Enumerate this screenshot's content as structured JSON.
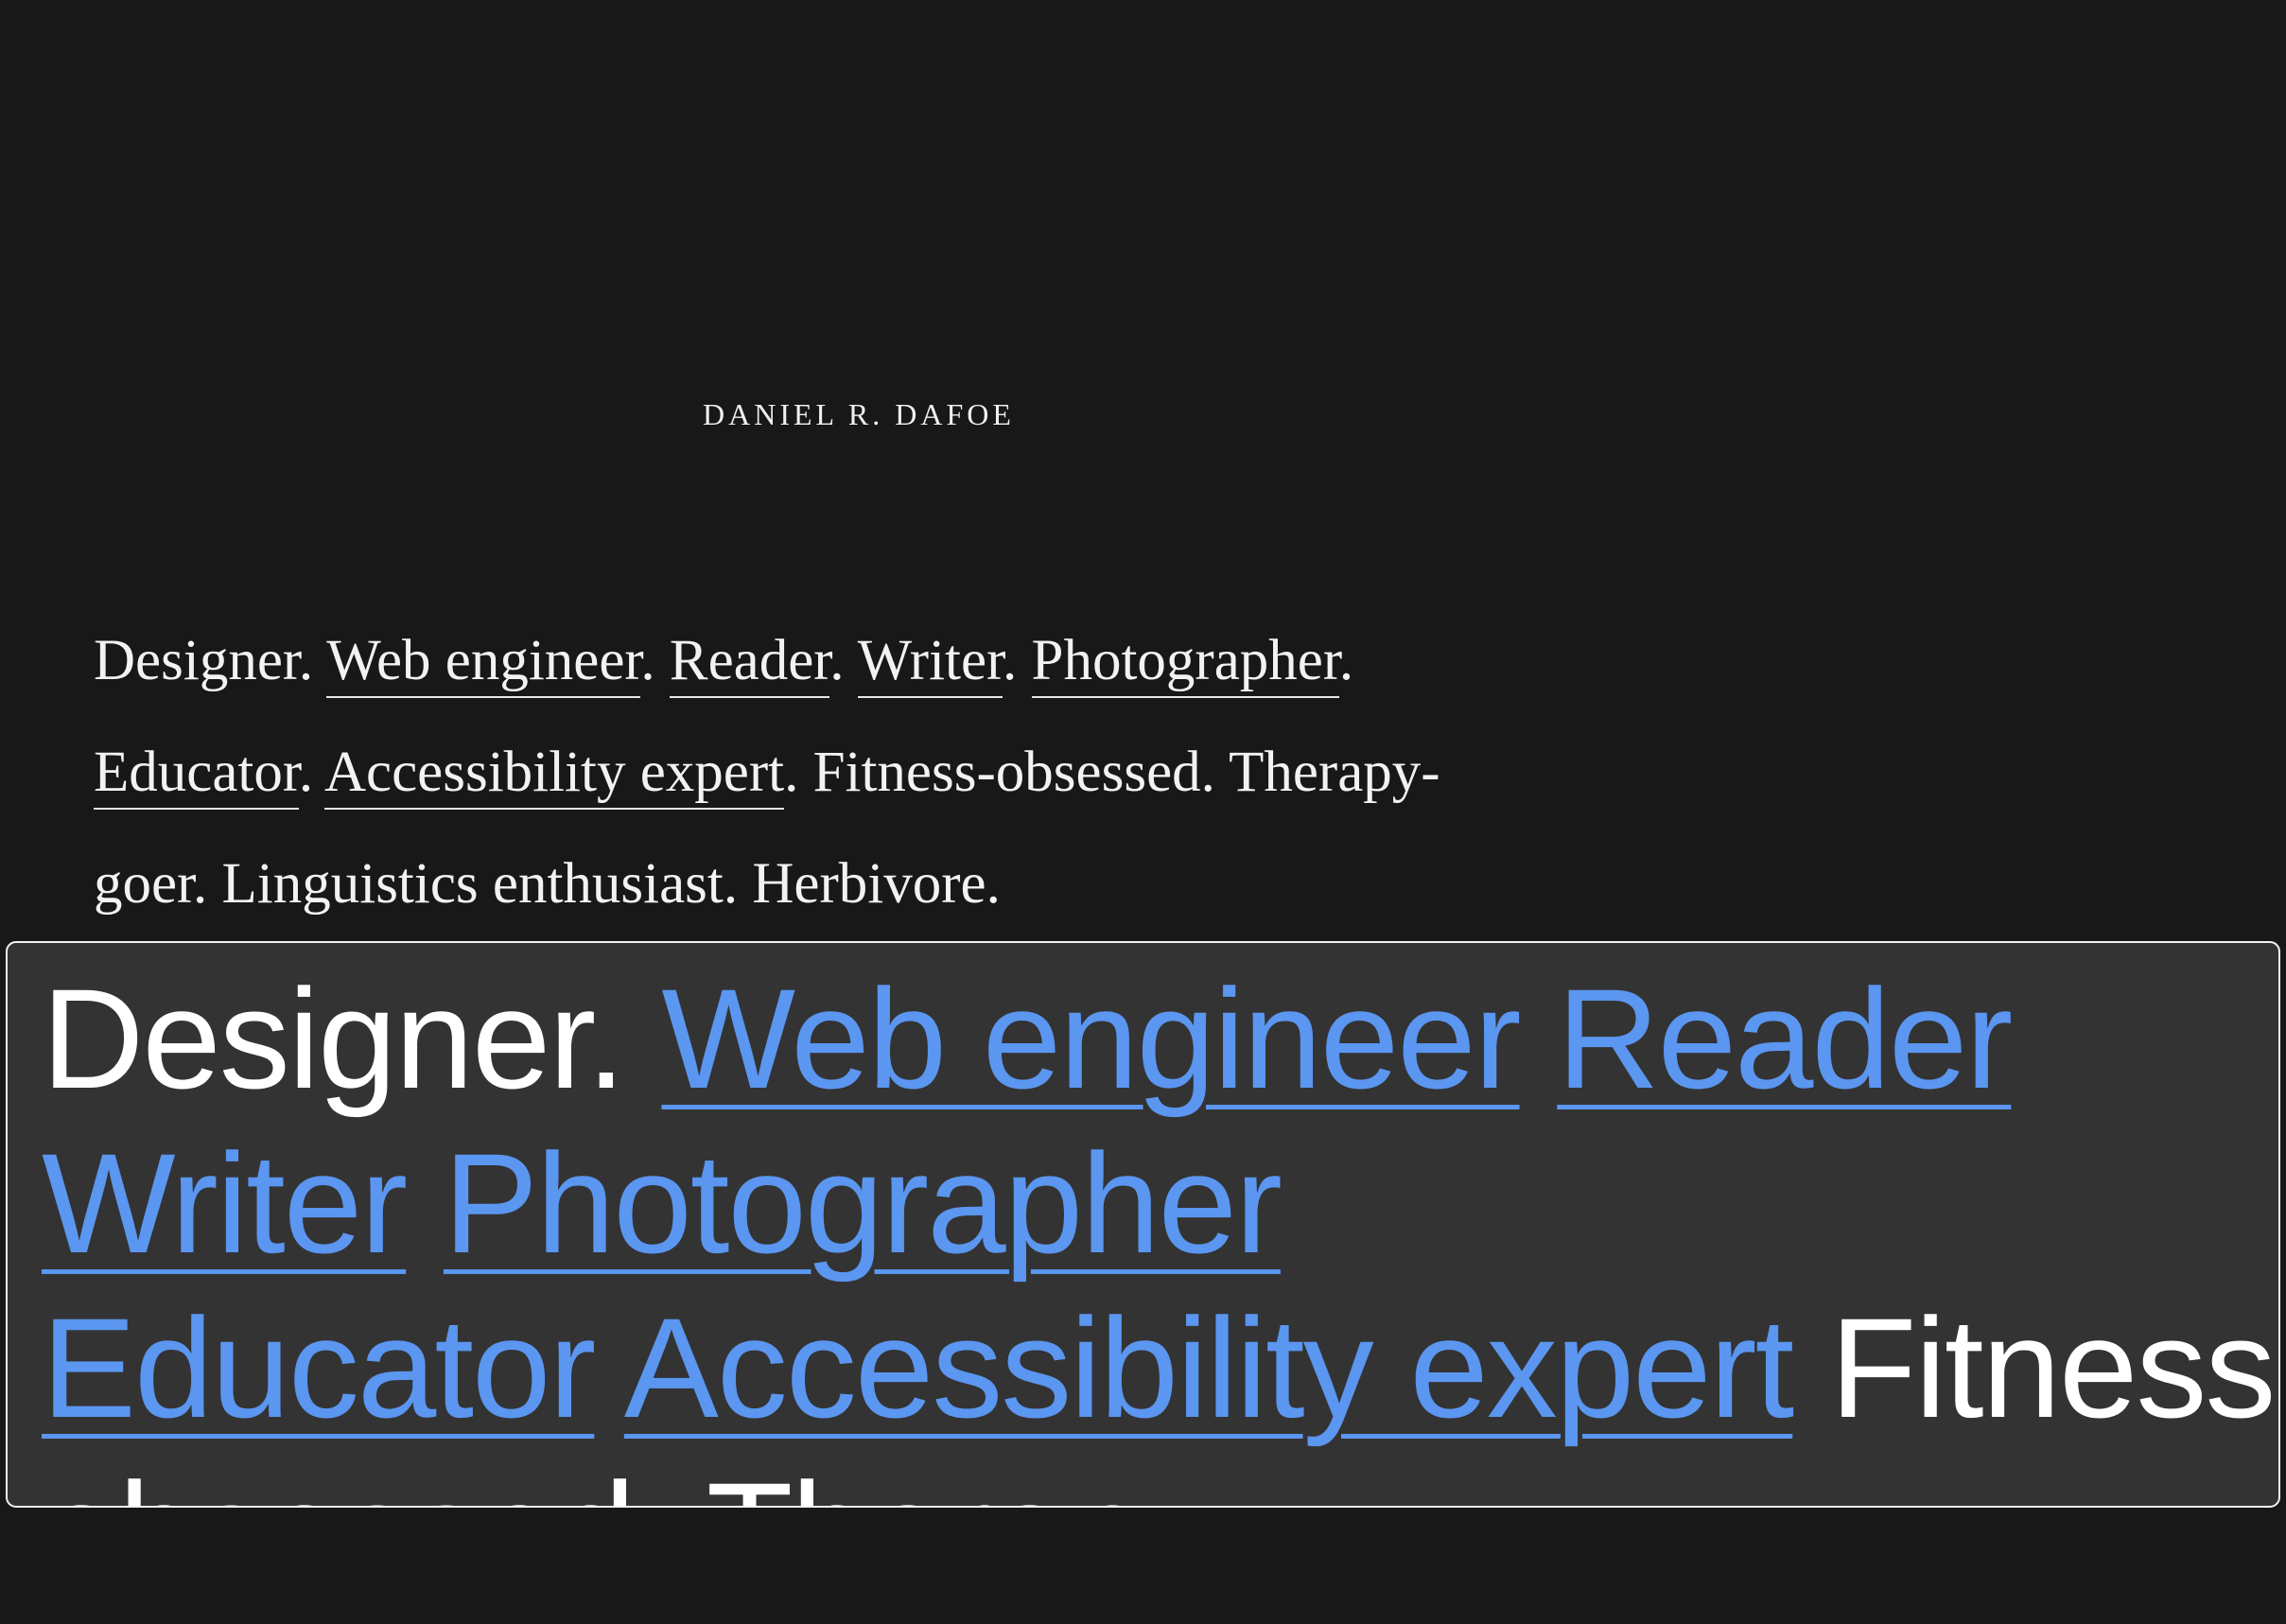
{
  "header": {
    "site_name": "DANIEL R. DAFOE"
  },
  "bio": {
    "items": [
      {
        "text": "Designer.",
        "link": false
      },
      {
        "text": "Web engineer",
        "link": true
      },
      {
        "text": "Reader",
        "link": true
      },
      {
        "text": "Writer",
        "link": true
      },
      {
        "text": "Photographer",
        "link": true
      },
      {
        "text": "Educator",
        "link": true
      },
      {
        "text": "Accessibility expert",
        "link": true
      },
      {
        "text": "Fitness-obsessed.",
        "link": false
      },
      {
        "text": "Therapy-goer.",
        "link": false
      },
      {
        "text": "Linguistics enthusiast.",
        "link": false
      },
      {
        "text": "Herbivore.",
        "link": false
      }
    ],
    "fitness_part1": "Fitness-",
    "fitness_part2": "obsessed.",
    "therapy_part1": "Therapy-",
    "therapy_part2": "goer.",
    "period": "."
  },
  "magnifier": {
    "designer": "Designer.",
    "web_engineer": "Web engineer",
    "reader": "Reader",
    "writer": "Writer",
    "photographer": "Photographer",
    "educator": "Educator",
    "accessibility_expert": "Accessibility expert",
    "fitness_part1": "Fitness-",
    "fitness_part2": "obsessed.",
    "therapy_clipped": "Therapy-",
    "link_color": "#5b96f0",
    "background_color": "#333333"
  },
  "colors": {
    "page_background": "#181818",
    "text": "#f2f2f2"
  }
}
